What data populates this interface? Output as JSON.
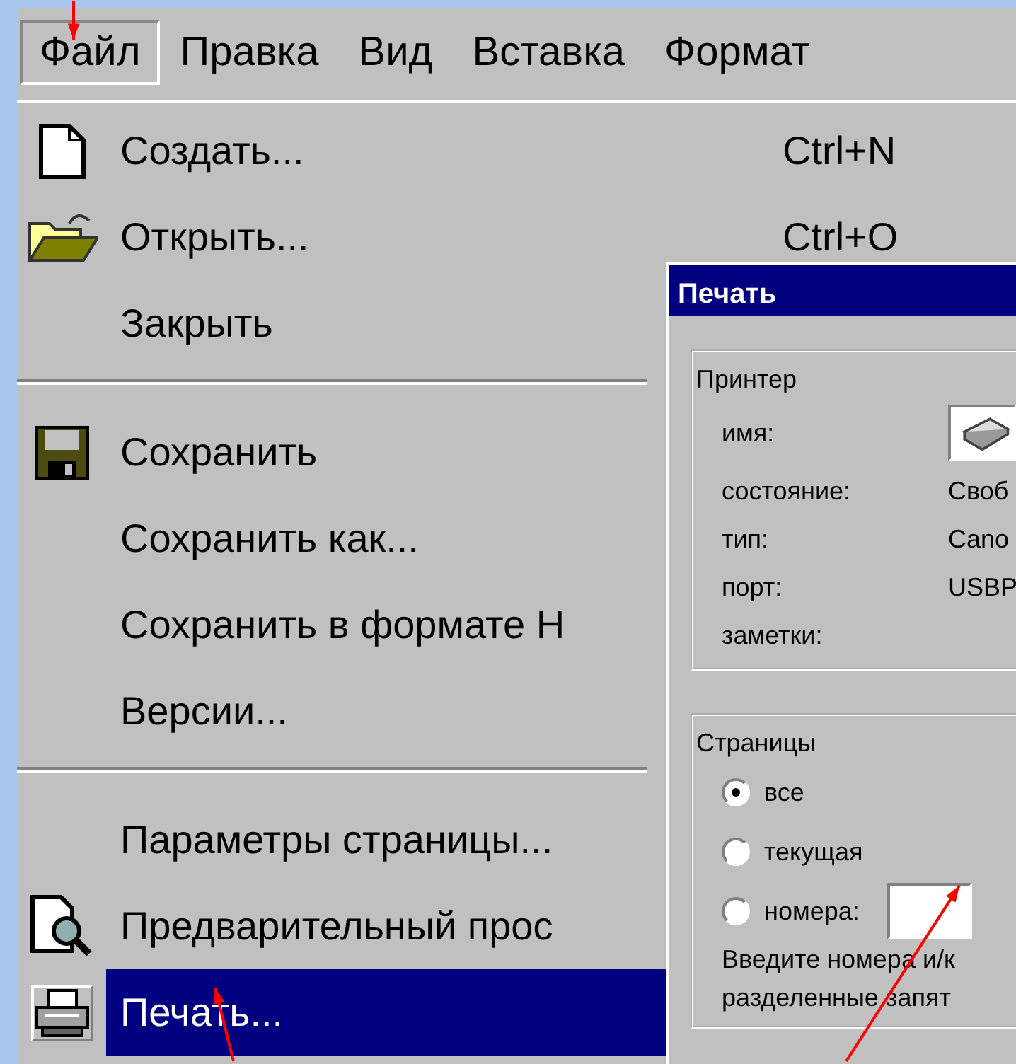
{
  "menu_bar": [
    {
      "label": "Файл",
      "selected": true
    },
    {
      "label": "Правка",
      "selected": false
    },
    {
      "label": "Вид",
      "selected": false
    },
    {
      "label": "Вставка",
      "selected": false
    },
    {
      "label": "Формат",
      "selected": false
    }
  ],
  "file_menu": [
    {
      "kind": "item",
      "label": "Создать...",
      "shortcut": "Ctrl+N",
      "selected": false
    },
    {
      "kind": "item",
      "label": "Открыть...",
      "shortcut": "Ctrl+O",
      "selected": false
    },
    {
      "kind": "item",
      "label": "Закрыть",
      "selected": false
    },
    {
      "kind": "separator"
    },
    {
      "kind": "item",
      "label": "Сохранить",
      "selected": false
    },
    {
      "kind": "item",
      "label": "Сохранить как...",
      "selected": false
    },
    {
      "kind": "item",
      "label": "Сохранить в формате Н",
      "selected": false
    },
    {
      "kind": "item",
      "label": "Версии...",
      "selected": false
    },
    {
      "kind": "separator"
    },
    {
      "kind": "item",
      "label": "Параметры страницы...",
      "selected": false
    },
    {
      "kind": "item",
      "label": "Предварительный прос",
      "selected": false
    },
    {
      "kind": "item",
      "label": "Печать...",
      "selected": true
    }
  ],
  "print_dialog": {
    "title": "Печать",
    "printer": {
      "legend": "Принтер",
      "rows": [
        {
          "kind": "select",
          "label": "имя:"
        },
        {
          "kind": "text",
          "label": "состояние:",
          "value": "Своб"
        },
        {
          "kind": "text",
          "label": "тип:",
          "value": "Cano"
        },
        {
          "kind": "text",
          "label": "порт:",
          "value": "USBP"
        },
        {
          "kind": "text",
          "label": "заметки:"
        }
      ]
    },
    "pages": {
      "legend": "Страницы",
      "options": [
        {
          "kind": "plain",
          "label": "все",
          "selected": true
        },
        {
          "kind": "plain",
          "label": "текущая",
          "selected": false
        },
        {
          "kind": "with_field",
          "label": "номера:",
          "selected": false
        }
      ],
      "hint": [
        "Введите номера и/к",
        "разделенные запят"
      ]
    }
  }
}
